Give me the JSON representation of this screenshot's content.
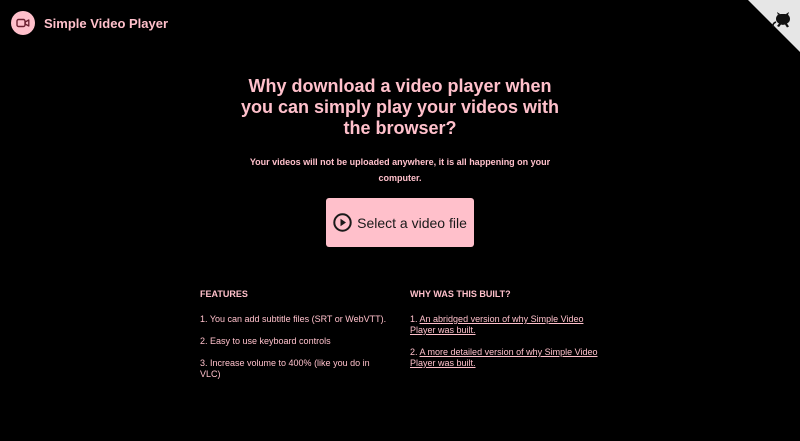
{
  "header": {
    "app_name": "Simple Video Player",
    "logo_icon": "video-camera-icon",
    "corner_icon": "github-octocat-icon"
  },
  "hero": {
    "headline": "Why download a video player when you can simply play your videos with the browser?",
    "subline": "Your videos will not be uploaded anywhere, it is all happening on your computer.",
    "select_button_label": "Select a video file",
    "select_button_icon": "play-circle-icon"
  },
  "features": {
    "title": "FEATURES",
    "items": [
      "1. You can add subtitle files (SRT or WebVTT).",
      "2. Easy to use keyboard controls",
      "3. Increase volume to 400% (like you do in VLC)"
    ]
  },
  "why": {
    "title": "WHY WAS THIS BUILT?",
    "items": [
      {
        "prefix": "1.",
        "link": "An abridged version of why Simple Video Player was built."
      },
      {
        "prefix": "2.",
        "link": "A more detailed version of why Simple Video Player was built."
      }
    ]
  },
  "colors": {
    "background": "#000000",
    "accent": "#ffc0cb",
    "button_text": "#1a1a1a"
  }
}
